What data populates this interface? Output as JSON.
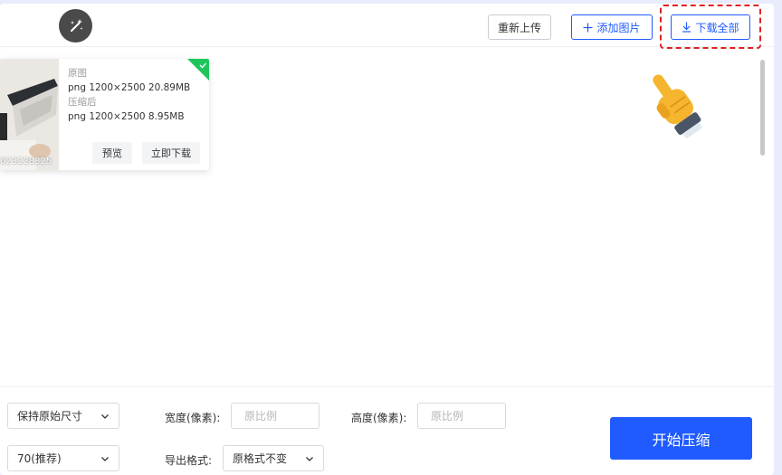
{
  "toolbar": {
    "reupload_label": "重新上传",
    "add_image_label": "添加图片",
    "download_all_label": "下载全部"
  },
  "card": {
    "thumb_caption": "023228325",
    "original_label": "原图",
    "original_meta": "png  1200×2500  20.89MB",
    "compressed_label": "压缩后",
    "compressed_meta": "png  1200×2500  8.95MB",
    "preview_label": "预览",
    "download_now_label": "立即下载"
  },
  "options": {
    "size_mode": "保持原始尺寸",
    "width_label": "宽度(像素):",
    "width_placeholder": "原比例",
    "height_label": "高度(像素):",
    "height_placeholder": "原比例",
    "quality": "70(推荐)",
    "export_format_label": "导出格式:",
    "export_format": "原格式不变"
  },
  "start_label": "开始压缩",
  "colors": {
    "accent": "#1f5bff",
    "highlight_dash": "#e02020",
    "success_corner": "#1ec65a",
    "page_bg": "#e9ecfb"
  },
  "icons": [
    "magic-wand-icon",
    "plus-icon",
    "download-icon",
    "pointing-hand-icon",
    "check-icon",
    "chevron-down-icon"
  ]
}
